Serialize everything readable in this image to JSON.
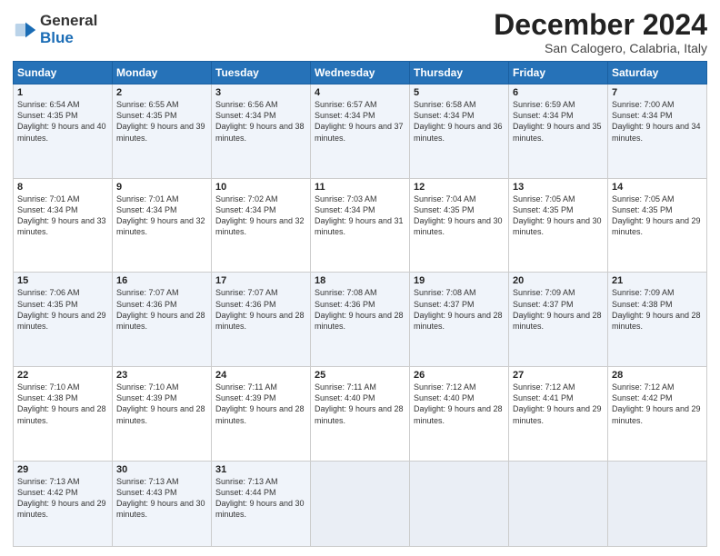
{
  "logo": {
    "general": "General",
    "blue": "Blue"
  },
  "header": {
    "month": "December 2024",
    "location": "San Calogero, Calabria, Italy"
  },
  "weekdays": [
    "Sunday",
    "Monday",
    "Tuesday",
    "Wednesday",
    "Thursday",
    "Friday",
    "Saturday"
  ],
  "weeks": [
    [
      {
        "day": "1",
        "sunrise": "6:54 AM",
        "sunset": "4:35 PM",
        "daylight": "9 hours and 40 minutes."
      },
      {
        "day": "2",
        "sunrise": "6:55 AM",
        "sunset": "4:35 PM",
        "daylight": "9 hours and 39 minutes."
      },
      {
        "day": "3",
        "sunrise": "6:56 AM",
        "sunset": "4:34 PM",
        "daylight": "9 hours and 38 minutes."
      },
      {
        "day": "4",
        "sunrise": "6:57 AM",
        "sunset": "4:34 PM",
        "daylight": "9 hours and 37 minutes."
      },
      {
        "day": "5",
        "sunrise": "6:58 AM",
        "sunset": "4:34 PM",
        "daylight": "9 hours and 36 minutes."
      },
      {
        "day": "6",
        "sunrise": "6:59 AM",
        "sunset": "4:34 PM",
        "daylight": "9 hours and 35 minutes."
      },
      {
        "day": "7",
        "sunrise": "7:00 AM",
        "sunset": "4:34 PM",
        "daylight": "9 hours and 34 minutes."
      }
    ],
    [
      {
        "day": "8",
        "sunrise": "7:01 AM",
        "sunset": "4:34 PM",
        "daylight": "9 hours and 33 minutes."
      },
      {
        "day": "9",
        "sunrise": "7:01 AM",
        "sunset": "4:34 PM",
        "daylight": "9 hours and 32 minutes."
      },
      {
        "day": "10",
        "sunrise": "7:02 AM",
        "sunset": "4:34 PM",
        "daylight": "9 hours and 32 minutes."
      },
      {
        "day": "11",
        "sunrise": "7:03 AM",
        "sunset": "4:34 PM",
        "daylight": "9 hours and 31 minutes."
      },
      {
        "day": "12",
        "sunrise": "7:04 AM",
        "sunset": "4:35 PM",
        "daylight": "9 hours and 30 minutes."
      },
      {
        "day": "13",
        "sunrise": "7:05 AM",
        "sunset": "4:35 PM",
        "daylight": "9 hours and 30 minutes."
      },
      {
        "day": "14",
        "sunrise": "7:05 AM",
        "sunset": "4:35 PM",
        "daylight": "9 hours and 29 minutes."
      }
    ],
    [
      {
        "day": "15",
        "sunrise": "7:06 AM",
        "sunset": "4:35 PM",
        "daylight": "9 hours and 29 minutes."
      },
      {
        "day": "16",
        "sunrise": "7:07 AM",
        "sunset": "4:36 PM",
        "daylight": "9 hours and 28 minutes."
      },
      {
        "day": "17",
        "sunrise": "7:07 AM",
        "sunset": "4:36 PM",
        "daylight": "9 hours and 28 minutes."
      },
      {
        "day": "18",
        "sunrise": "7:08 AM",
        "sunset": "4:36 PM",
        "daylight": "9 hours and 28 minutes."
      },
      {
        "day": "19",
        "sunrise": "7:08 AM",
        "sunset": "4:37 PM",
        "daylight": "9 hours and 28 minutes."
      },
      {
        "day": "20",
        "sunrise": "7:09 AM",
        "sunset": "4:37 PM",
        "daylight": "9 hours and 28 minutes."
      },
      {
        "day": "21",
        "sunrise": "7:09 AM",
        "sunset": "4:38 PM",
        "daylight": "9 hours and 28 minutes."
      }
    ],
    [
      {
        "day": "22",
        "sunrise": "7:10 AM",
        "sunset": "4:38 PM",
        "daylight": "9 hours and 28 minutes."
      },
      {
        "day": "23",
        "sunrise": "7:10 AM",
        "sunset": "4:39 PM",
        "daylight": "9 hours and 28 minutes."
      },
      {
        "day": "24",
        "sunrise": "7:11 AM",
        "sunset": "4:39 PM",
        "daylight": "9 hours and 28 minutes."
      },
      {
        "day": "25",
        "sunrise": "7:11 AM",
        "sunset": "4:40 PM",
        "daylight": "9 hours and 28 minutes."
      },
      {
        "day": "26",
        "sunrise": "7:12 AM",
        "sunset": "4:40 PM",
        "daylight": "9 hours and 28 minutes."
      },
      {
        "day": "27",
        "sunrise": "7:12 AM",
        "sunset": "4:41 PM",
        "daylight": "9 hours and 29 minutes."
      },
      {
        "day": "28",
        "sunrise": "7:12 AM",
        "sunset": "4:42 PM",
        "daylight": "9 hours and 29 minutes."
      }
    ],
    [
      {
        "day": "29",
        "sunrise": "7:13 AM",
        "sunset": "4:42 PM",
        "daylight": "9 hours and 29 minutes."
      },
      {
        "day": "30",
        "sunrise": "7:13 AM",
        "sunset": "4:43 PM",
        "daylight": "9 hours and 30 minutes."
      },
      {
        "day": "31",
        "sunrise": "7:13 AM",
        "sunset": "4:44 PM",
        "daylight": "9 hours and 30 minutes."
      },
      null,
      null,
      null,
      null
    ]
  ],
  "labels": {
    "sunrise": "Sunrise:",
    "sunset": "Sunset:",
    "daylight": "Daylight:"
  }
}
